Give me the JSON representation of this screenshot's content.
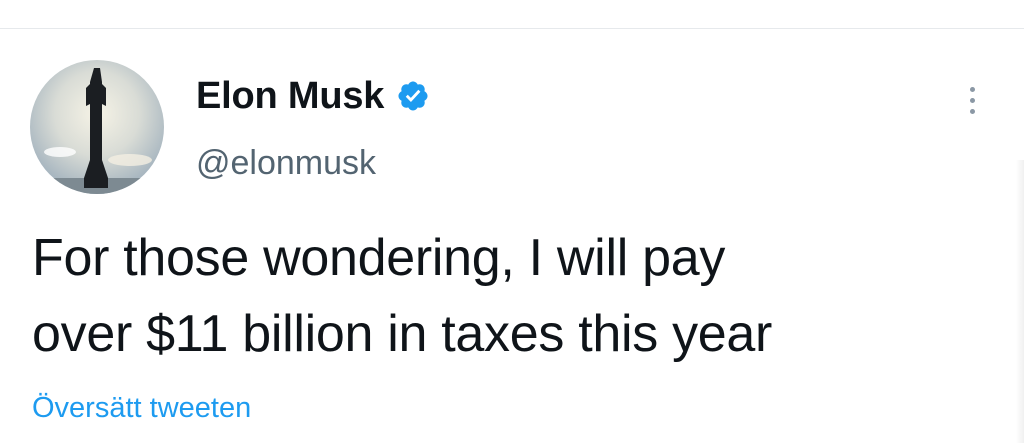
{
  "tweet": {
    "author": {
      "display_name": "Elon Musk",
      "handle": "@elonmusk",
      "verified": true,
      "avatar_icon": "starship-avatar"
    },
    "text_lines": [
      "For those wondering, I will pay",
      "over $11 billion in taxes this year"
    ],
    "translate_label": "Översätt tweeten",
    "more_icon": "more-vertical-icon"
  },
  "colors": {
    "verified_badge": "#1d9bf0",
    "link": "#1d9bf0",
    "handle": "#536471",
    "text": "#0f1419"
  }
}
